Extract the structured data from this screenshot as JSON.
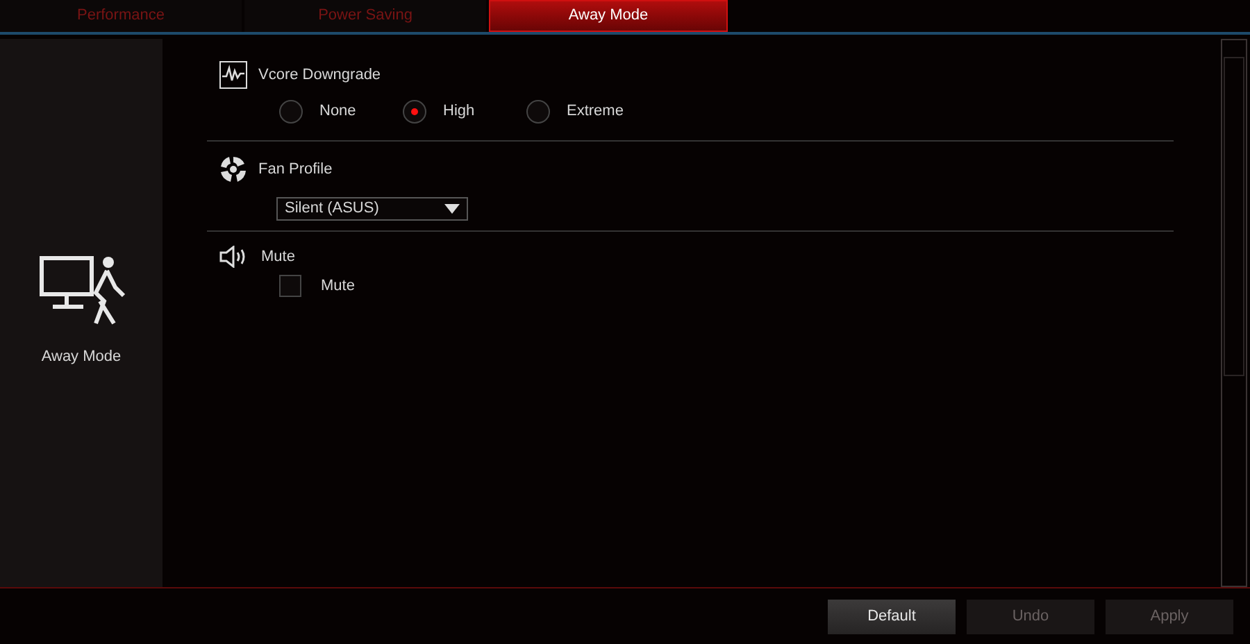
{
  "tabs": [
    {
      "label": "Performance",
      "selected": false
    },
    {
      "label": "Power Saving",
      "selected": false
    },
    {
      "label": "Away Mode",
      "selected": true
    }
  ],
  "sidebar": {
    "label": "Away Mode"
  },
  "sections": [
    {
      "kind": "radio",
      "title": "Vcore Downgrade",
      "options": [
        {
          "label": "None",
          "selected": false
        },
        {
          "label": "High",
          "selected": true
        },
        {
          "label": "Extreme",
          "selected": false
        }
      ]
    },
    {
      "kind": "dropdown",
      "title": "Fan Profile",
      "value": "Silent (ASUS)"
    },
    {
      "kind": "checkbox",
      "title": "Mute",
      "option": {
        "label": "Mute",
        "checked": false
      }
    }
  ],
  "buttons": [
    {
      "label": "Default",
      "disabled": false
    },
    {
      "label": "Undo",
      "disabled": true
    },
    {
      "label": "Apply",
      "disabled": true
    }
  ]
}
